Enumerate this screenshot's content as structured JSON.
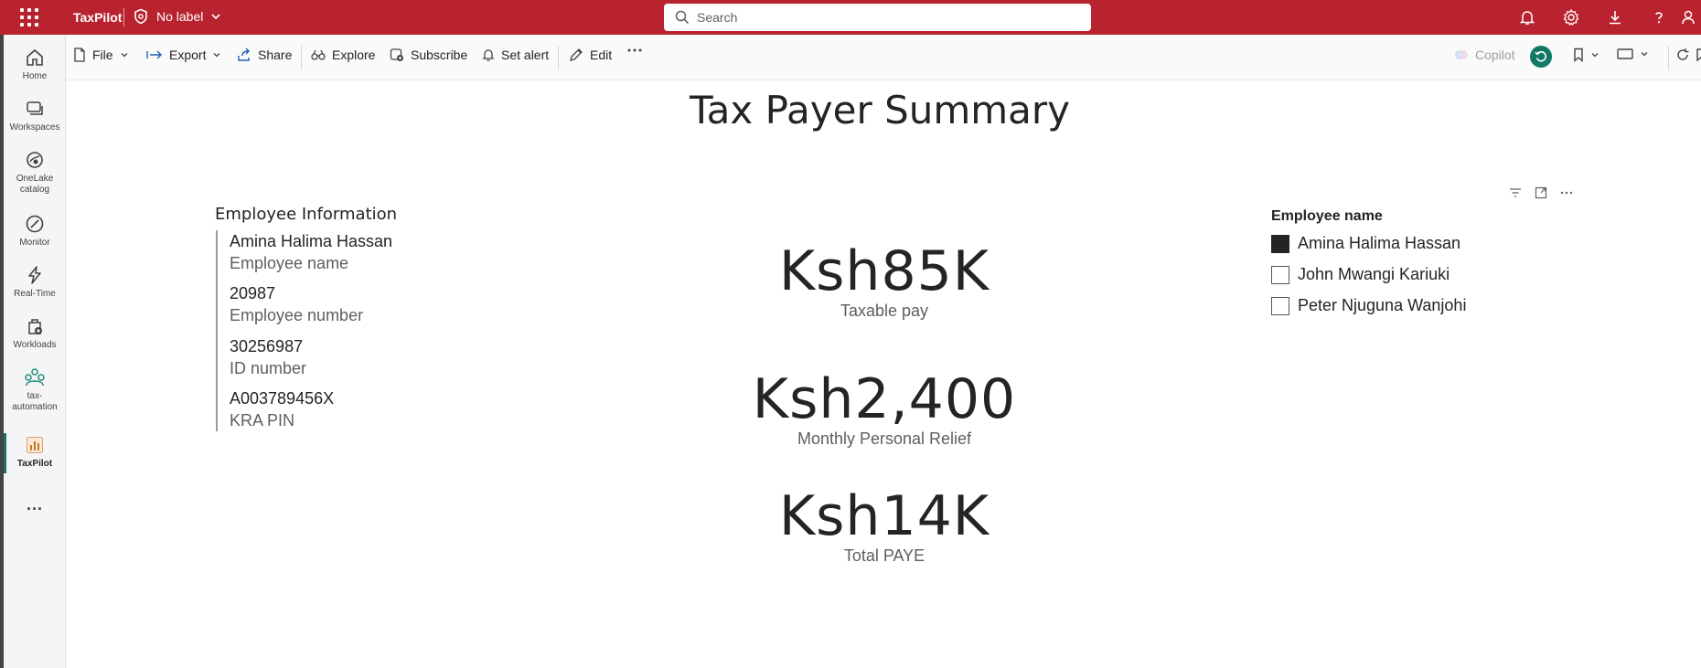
{
  "header": {
    "app_name": "TaxPilot",
    "sensitivity_label": "No label",
    "search_placeholder": "Search"
  },
  "rail": {
    "items": [
      {
        "label": "Home",
        "icon": "home-icon"
      },
      {
        "label": "Workspaces",
        "icon": "workspaces-icon"
      },
      {
        "label": "OneLake catalog",
        "icon": "onelake-icon"
      },
      {
        "label": "Monitor",
        "icon": "monitor-icon"
      },
      {
        "label": "Real-Time",
        "icon": "real-time-icon"
      },
      {
        "label": "Workloads",
        "icon": "workloads-icon"
      },
      {
        "label": "tax-automation",
        "icon": "tax-automation-icon"
      },
      {
        "label": "TaxPilot",
        "icon": "report-icon"
      }
    ],
    "more": "..."
  },
  "toolbar": {
    "file": "File",
    "export": "Export",
    "share": "Share",
    "explore": "Explore",
    "subscribe": "Subscribe",
    "set_alert": "Set alert",
    "edit": "Edit",
    "copilot": "Copilot"
  },
  "report": {
    "title": "Tax Payer Summary",
    "employee_card": {
      "title": "Employee Information",
      "rows": [
        {
          "value": "Amina Halima Hassan",
          "label": "Employee name"
        },
        {
          "value": "20987",
          "label": "Employee number"
        },
        {
          "value": "30256987",
          "label": "ID number"
        },
        {
          "value": "A003789456X",
          "label": "KRA PIN"
        }
      ]
    },
    "kpis": [
      {
        "value": "Ksh85K",
        "label": "Taxable pay"
      },
      {
        "value": "Ksh2,400",
        "label": "Monthly Personal Relief"
      },
      {
        "value": "Ksh14K",
        "label": "Total PAYE"
      }
    ],
    "slicer": {
      "title": "Employee name",
      "options": [
        {
          "label": "Amina Halima Hassan",
          "checked": true
        },
        {
          "label": "John Mwangi Kariuki",
          "checked": false
        },
        {
          "label": "Peter Njuguna Wanjohi",
          "checked": false
        }
      ]
    }
  },
  "colors": {
    "header_bg": "#b9222f",
    "accent_teal": "#117865",
    "text_primary": "#252423",
    "text_secondary": "#605e5c"
  }
}
